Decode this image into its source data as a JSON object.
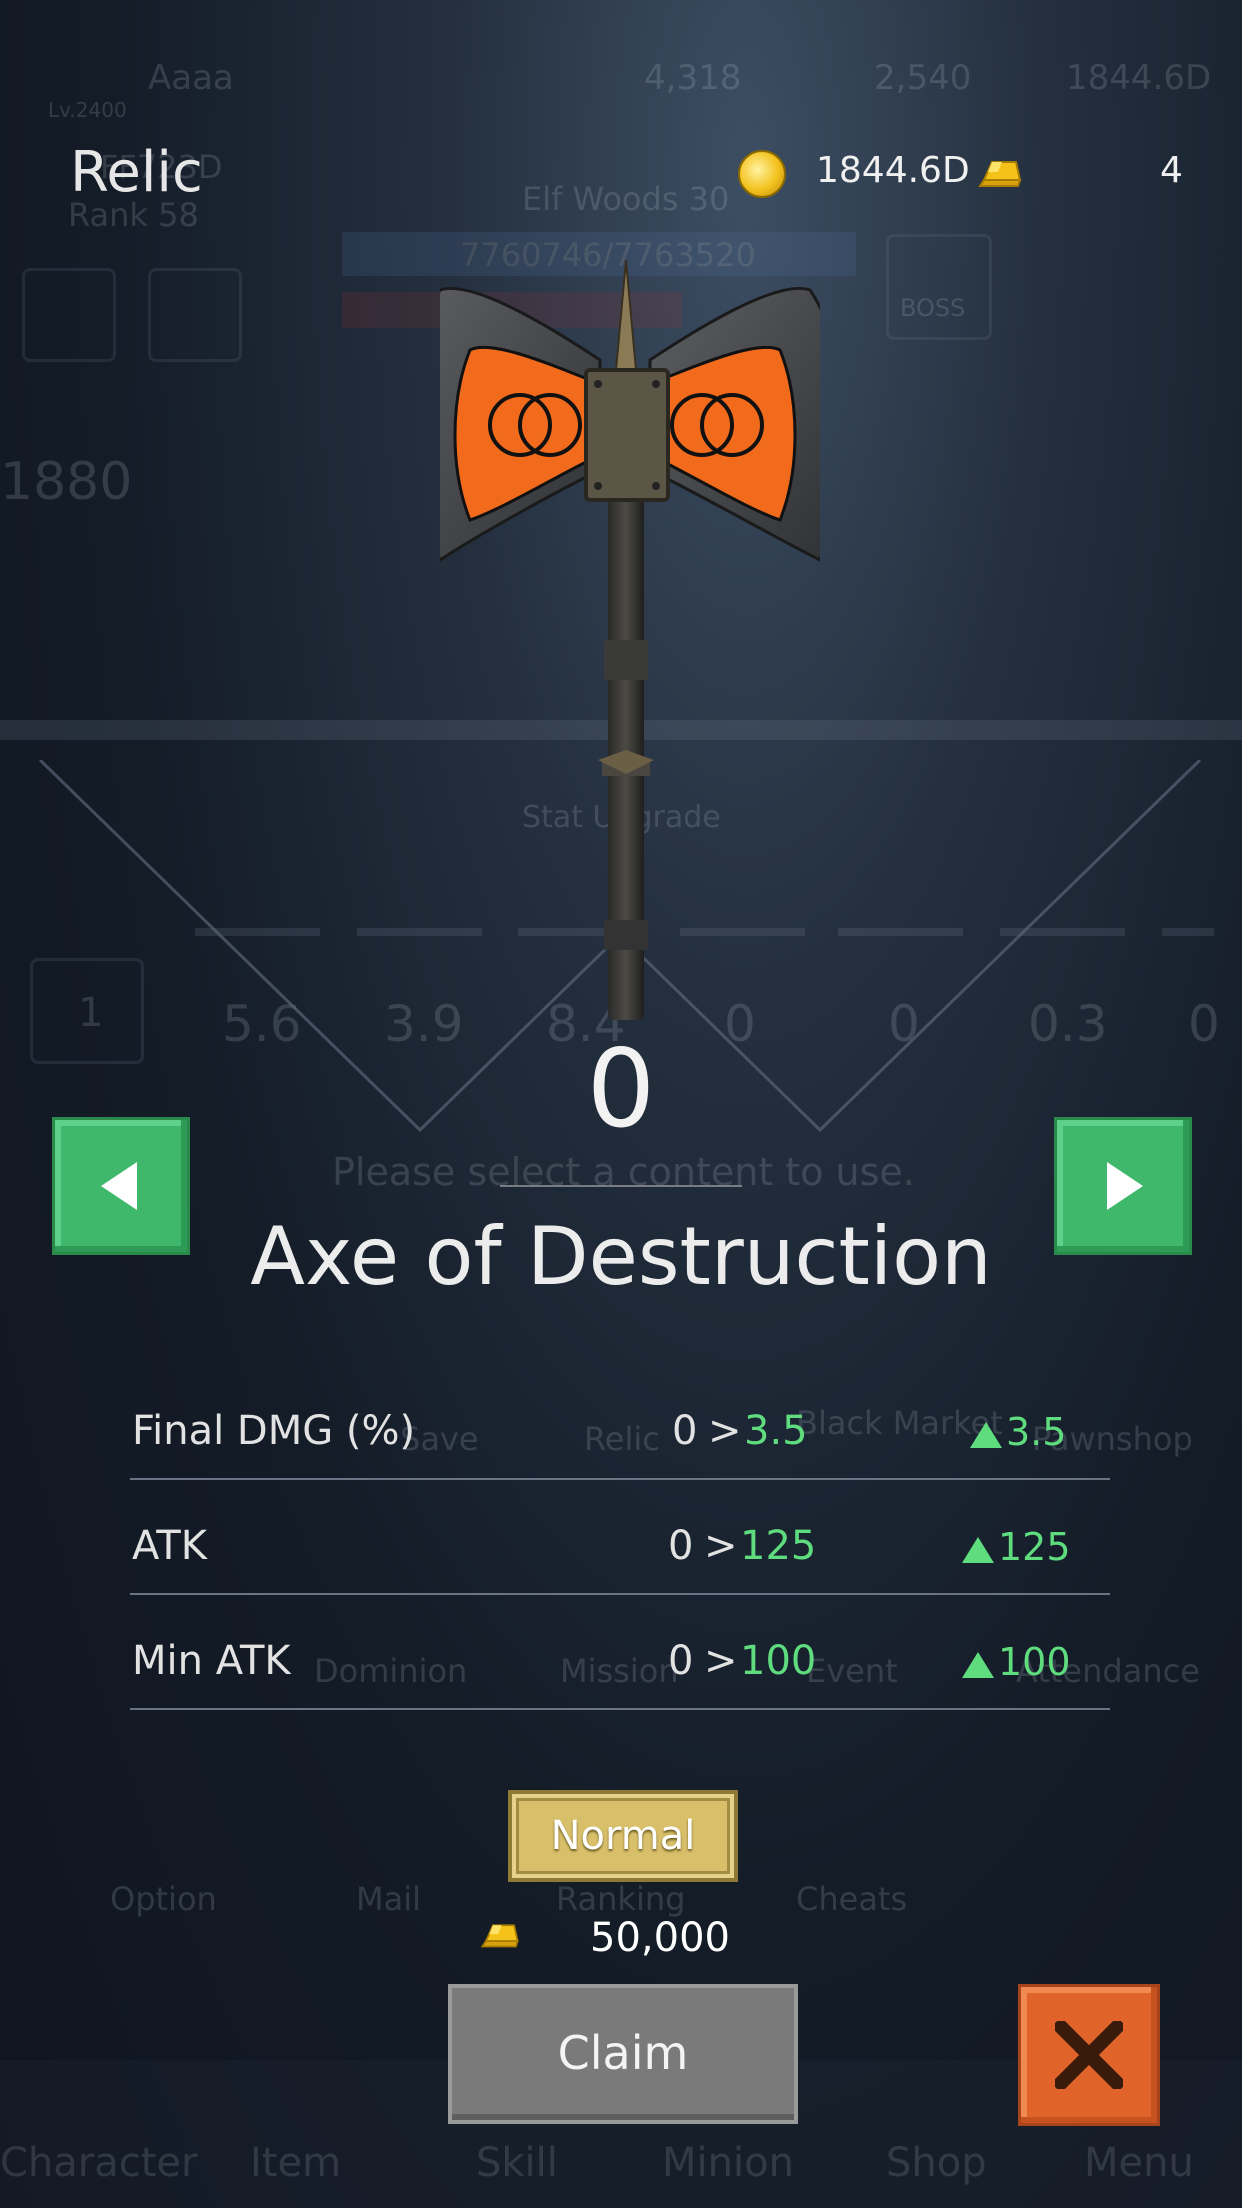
{
  "background": {
    "player_name": "Aaaa",
    "level": "Lv.2400",
    "stat1": "4,318",
    "stat2": "2,540",
    "stat3": "1844.6D",
    "power": "FF723D",
    "rank": "Rank 58",
    "stage": "Elf Woods 30",
    "hp": "7760746/7763520",
    "boss": "BOSS",
    "score": "1880",
    "stat_upgrade": "Stat Upgrade",
    "slots": [
      "1",
      "5.6",
      "3.9",
      "8.4",
      "0",
      "0",
      "0.3",
      "0"
    ],
    "prompt": "Please select a content to use.",
    "menu_row1": [
      "Save",
      "Relic",
      "Black Market",
      "Pawnshop"
    ],
    "menu_row2": [
      "Dominion",
      "Mission",
      "Event",
      "Attendance"
    ],
    "menu_row3": [
      "Option",
      "Mail",
      "Ranking",
      "Cheats"
    ],
    "bottom_tabs": [
      "Character",
      "Item",
      "Skill",
      "Minion",
      "Shop",
      "Menu"
    ]
  },
  "header": {
    "title": "Relic",
    "gold": "1844.6D",
    "gems": "4",
    "gold_icon": "gold-coin-icon",
    "gem_icon": "gold-ingot-icon"
  },
  "relic": {
    "level": "0",
    "name": "Axe of Destruction",
    "image_icon": "double-axe-icon"
  },
  "stats": [
    {
      "label": "Final DMG (%)",
      "from": "0",
      "arrow": ">",
      "to": "3.5",
      "delta": "3.5"
    },
    {
      "label": "ATK",
      "from": "0",
      "arrow": ">",
      "to": "125",
      "delta": "125"
    },
    {
      "label": "Min ATK",
      "from": "0",
      "arrow": ">",
      "to": "100",
      "delta": "100"
    }
  ],
  "grade": "Normal",
  "cost": "50,000",
  "buttons": {
    "claim": "Claim",
    "prev_icon": "arrow-left-icon",
    "next_icon": "arrow-right-icon",
    "close_icon": "close-icon"
  },
  "colors": {
    "accent_green": "#3fb86b",
    "value_green": "#5fdc7e",
    "close_orange": "#e0642a",
    "grade_gold": "#d8bf6a"
  }
}
